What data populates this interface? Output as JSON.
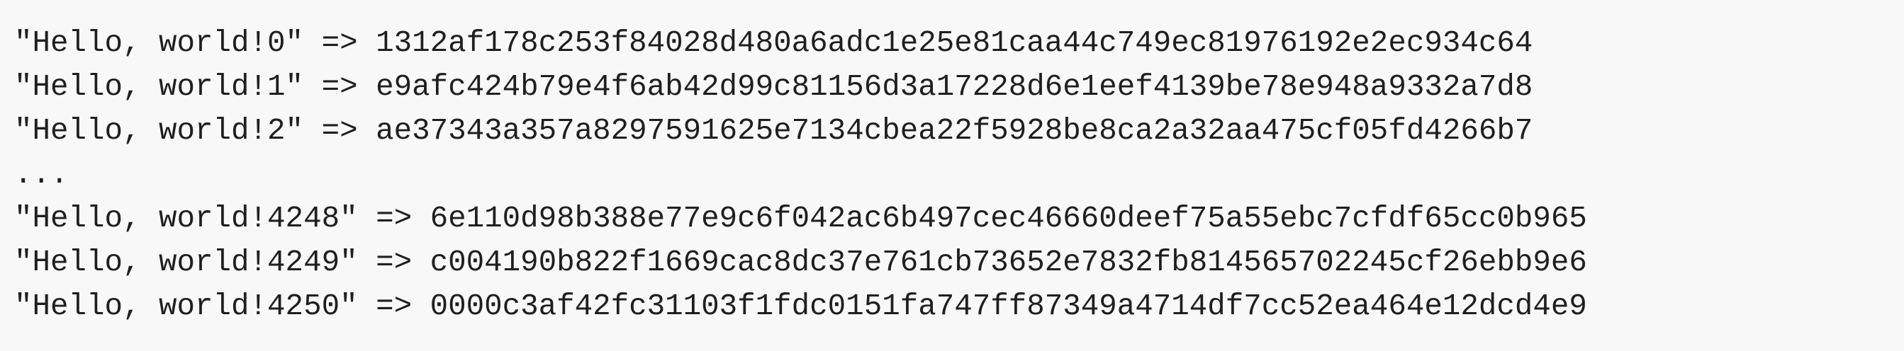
{
  "lines": [
    "\"Hello, world!0\" => 1312af178c253f84028d480a6adc1e25e81caa44c749ec81976192e2ec934c64",
    "\"Hello, world!1\" => e9afc424b79e4f6ab42d99c81156d3a17228d6e1eef4139be78e948a9332a7d8",
    "\"Hello, world!2\" => ae37343a357a8297591625e7134cbea22f5928be8ca2a32aa475cf05fd4266b7",
    "...",
    "\"Hello, world!4248\" => 6e110d98b388e77e9c6f042ac6b497cec46660deef75a55ebc7cfdf65cc0b965",
    "\"Hello, world!4249\" => c004190b822f1669cac8dc37e761cb73652e7832fb814565702245cf26ebb9e6",
    "\"Hello, world!4250\" => 0000c3af42fc31103f1fdc0151fa747ff87349a4714df7cc52ea464e12dcd4e9"
  ]
}
